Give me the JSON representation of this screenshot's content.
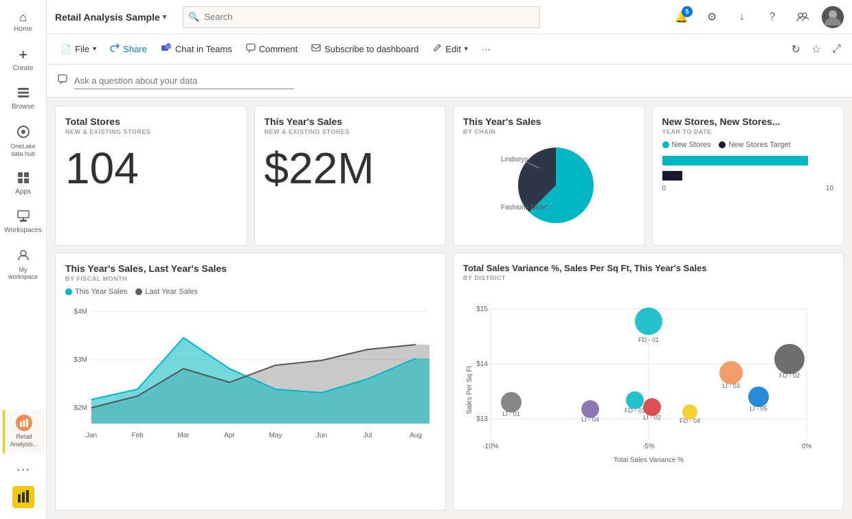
{
  "topbar": {
    "title": "Retail Analysis Sample",
    "chevron": "▾",
    "search_placeholder": "Search",
    "notifications_count": "5",
    "icons": {
      "settings": "⚙",
      "download": "↓",
      "help": "?",
      "people": "👥"
    }
  },
  "actionbar": {
    "file_label": "File",
    "share_label": "Share",
    "chat_in_teams_label": "Chat in Teams",
    "comment_label": "Comment",
    "subscribe_label": "Subscribe to dashboard",
    "edit_label": "Edit",
    "more_label": "···"
  },
  "qa": {
    "placeholder": "Ask a question about your data"
  },
  "sidebar": {
    "items": [
      {
        "label": "Home",
        "icon": "⌂"
      },
      {
        "label": "Create",
        "icon": "+"
      },
      {
        "label": "Browse",
        "icon": "⊟"
      },
      {
        "label": "OneLake data hub",
        "icon": "◎"
      },
      {
        "label": "Apps",
        "icon": "⊞"
      },
      {
        "label": "Workspaces",
        "icon": "⊡"
      },
      {
        "label": "My workspace",
        "icon": "👤"
      }
    ],
    "active_item": "Retail Analysis...",
    "more_label": "···"
  },
  "cards": {
    "total_stores": {
      "title": "Total Stores",
      "subtitle": "NEW & EXISTING STORES",
      "value": "104"
    },
    "this_years_sales": {
      "title": "This Year's Sales",
      "subtitle": "NEW & EXISTING STORES",
      "value": "$22M"
    },
    "sales_by_chain": {
      "title": "This Year's Sales",
      "subtitle": "BY CHAIN",
      "labels": [
        "Lindseys",
        "Fashions Direct"
      ]
    },
    "new_stores": {
      "title": "New Stores, New Stores...",
      "subtitle": "YEAR TO DATE",
      "legend_new_stores": "New Stores",
      "legend_target": "New Stores Target",
      "bar1_val": 85,
      "bar2_val": 12,
      "x_start": "0",
      "x_end": "10"
    },
    "line_chart": {
      "title": "This Year's Sales, Last Year's Sales",
      "subtitle": "BY FISCAL MONTH",
      "legend_this": "This Year Sales",
      "legend_last": "Last Year Sales",
      "y_top": "$4M",
      "y_mid": "$3M",
      "y_bot": "$2M",
      "x_labels": [
        "Jan",
        "Feb",
        "Mar",
        "Apr",
        "May",
        "Jun",
        "Jul",
        "Aug"
      ]
    },
    "scatter": {
      "title": "Total Sales Variance %, Sales Per Sq Ft, This Year's Sales",
      "subtitle": "BY DISTRICT",
      "x_label": "Total Sales Variance %",
      "y_label": "Sales Per Sq Ft",
      "x_min": "-10%",
      "x_max": "0%",
      "x_mid": "-5%",
      "y_top": "$15",
      "y_mid": "$14",
      "y_low": "$13",
      "points": [
        {
          "id": "FD-01",
          "x": 52,
          "y": 18,
          "r": 18,
          "color": "#00b7c3"
        },
        {
          "id": "FD-02",
          "x": 92,
          "y": 38,
          "r": 22,
          "color": "#555"
        },
        {
          "id": "LI-01",
          "x": 10,
          "y": 62,
          "r": 15,
          "color": "#737373"
        },
        {
          "id": "LI-03",
          "x": 74,
          "y": 30,
          "r": 17,
          "color": "#f28b50"
        },
        {
          "id": "FD-03",
          "x": 50,
          "y": 60,
          "r": 13,
          "color": "#00b7c3"
        },
        {
          "id": "LI-04",
          "x": 38,
          "y": 68,
          "r": 13,
          "color": "#7b5ea7"
        },
        {
          "id": "LI-02",
          "x": 55,
          "y": 70,
          "r": 13,
          "color": "#d13438"
        },
        {
          "id": "FD-04",
          "x": 65,
          "y": 74,
          "r": 11,
          "color": "#f2c811"
        },
        {
          "id": "LI-05",
          "x": 82,
          "y": 60,
          "r": 15,
          "color": "#0078d4"
        }
      ]
    }
  }
}
